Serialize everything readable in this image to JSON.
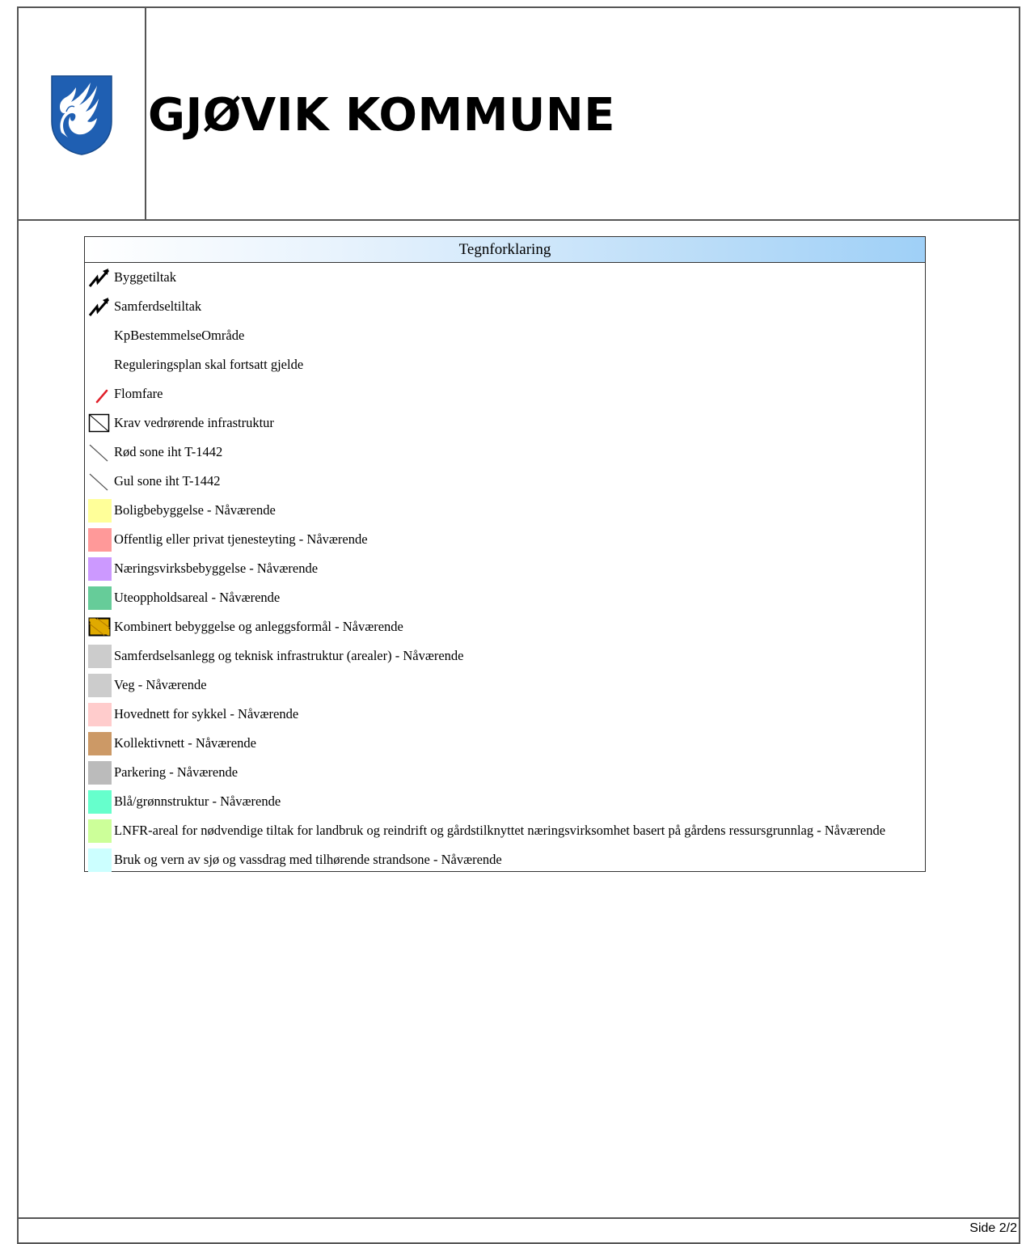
{
  "header": {
    "title": "GJØVIK KOMMUNE",
    "logo_icon": "swan-coat-of-arms-icon",
    "logo_colors": {
      "blue": "#1f5fb2",
      "white": "#ffffff"
    }
  },
  "legend": {
    "heading": "Tegnforklaring",
    "items": [
      {
        "label": "Byggetiltak",
        "symbol": "zigzag-arrow-icon"
      },
      {
        "label": "Samferdseltiltak",
        "symbol": "zigzag-arrow-icon"
      },
      {
        "label": "KpBestemmelseOmråde",
        "symbol": "none"
      },
      {
        "label": "Reguleringsplan skal fortsatt gjelde",
        "symbol": "none"
      },
      {
        "label": "Flomfare",
        "symbol": "red-line-icon",
        "color": "#e0202a"
      },
      {
        "label": "Krav vedrørende infrastruktur",
        "symbol": "crossed-box-icon"
      },
      {
        "label": "Rød sone iht T-1442",
        "symbol": "diagonal-line-icon"
      },
      {
        "label": "Gul sone iht T-1442",
        "symbol": "diagonal-line-icon"
      },
      {
        "label": "Boligbebyggelse - Nåværende",
        "symbol": "color-swatch",
        "color": "#ffff99"
      },
      {
        "label": "Offentlig eller privat tjenesteyting - Nåværende",
        "symbol": "color-swatch",
        "color": "#ff9999"
      },
      {
        "label": "Næringsvirksbebyggelse - Nåværende",
        "symbol": "color-swatch",
        "color": "#cc99ff"
      },
      {
        "label": "Uteoppholdsareal - Nåværende",
        "symbol": "color-swatch",
        "color": "#66cc99"
      },
      {
        "label": "Kombinert bebyggelse og anleggsformål - Nåværende",
        "symbol": "hatched-swatch",
        "color": "#e0aa00"
      },
      {
        "label": "Samferdselsanlegg og teknisk infrastruktur (arealer) - Nåværende",
        "symbol": "color-swatch",
        "color": "#cccccc"
      },
      {
        "label": "Veg - Nåværende",
        "symbol": "color-swatch",
        "color": "#cccccc"
      },
      {
        "label": "Hovednett for sykkel - Nåværende",
        "symbol": "color-swatch",
        "color": "#ffcccc"
      },
      {
        "label": "Kollektivnett - Nåværende",
        "symbol": "color-swatch",
        "color": "#cc9966"
      },
      {
        "label": "Parkering - Nåværende",
        "symbol": "color-swatch",
        "color": "#bbbbbb"
      },
      {
        "label": "Blå/grønnstruktur - Nåværende",
        "symbol": "color-swatch",
        "color": "#66ffcc"
      },
      {
        "label": "LNFR-areal for nødvendige tiltak for landbruk og reindrift og gårdstilknyttet næringsvirksomhet basert på gårdens ressursgrunnlag - Nåværende",
        "symbol": "color-swatch",
        "color": "#ccff99"
      },
      {
        "label": "Bruk og vern av sjø og vassdrag med tilhørende strandsone - Nåværende",
        "symbol": "color-swatch",
        "color": "#ccffff"
      }
    ]
  },
  "footer": {
    "page": "Side 2/2"
  }
}
